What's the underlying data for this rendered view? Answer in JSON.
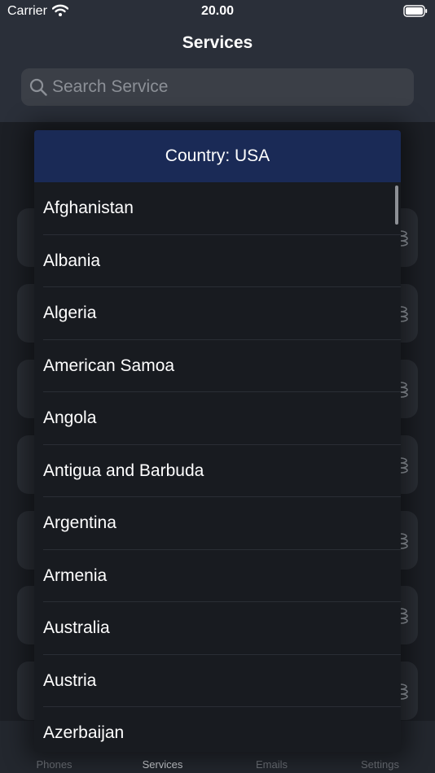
{
  "status_bar": {
    "carrier": "Carrier",
    "time": "20.00"
  },
  "nav": {
    "title": "Services"
  },
  "search": {
    "placeholder": "Search Service",
    "value": ""
  },
  "dropdown": {
    "header": "Country: USA",
    "countries": [
      "Afghanistan",
      "Albania",
      "Algeria",
      "American Samoa",
      "Angola",
      "Antigua and Barbuda",
      "Argentina",
      "Armenia",
      "Australia",
      "Austria",
      "Azerbaijan"
    ]
  },
  "tabs": [
    {
      "label": "Phones",
      "icon": "phone-icon",
      "active": false
    },
    {
      "label": "Services",
      "icon": "services-icon",
      "active": true
    },
    {
      "label": "Emails",
      "icon": "email-icon",
      "active": false
    },
    {
      "label": "Settings",
      "icon": "settings-icon",
      "active": false
    }
  ],
  "colors": {
    "header_bg": "#2a2f39",
    "dropdown_header_bg": "#1a2a56",
    "dropdown_bg": "#181b20",
    "search_bg": "#3b3f47"
  }
}
